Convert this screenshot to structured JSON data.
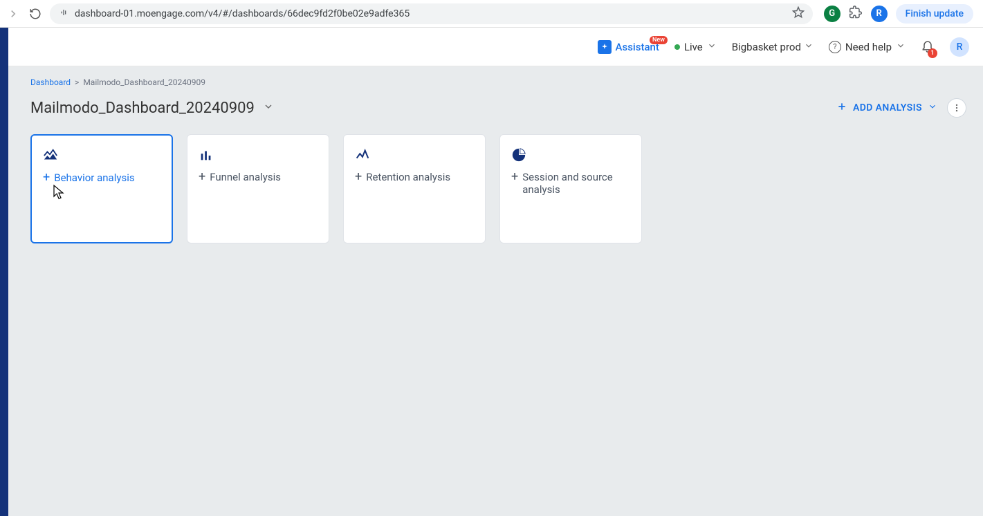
{
  "browser": {
    "url": "dashboard-01.moengage.com/v4/#/dashboards/66dec9fd2f0be02e9adfe365",
    "finish_update_label": "Finish update",
    "profile_initial": "R",
    "ext_g": "G"
  },
  "header": {
    "assistant_label": "Assistant",
    "assistant_badge": "New",
    "live_label": "Live",
    "workspace_label": "Bigbasket prod",
    "help_label": "Need help",
    "bell_count": "1",
    "avatar_initial": "R"
  },
  "breadcrumb": {
    "root": "Dashboard",
    "sep": ">",
    "current": "Mailmodo_Dashboard_20240909"
  },
  "title": "Mailmodo_Dashboard_20240909",
  "add_analysis_label": "ADD ANALYSIS",
  "cards": [
    {
      "label": "Behavior analysis",
      "active": true
    },
    {
      "label": "Funnel analysis",
      "active": false
    },
    {
      "label": "Retention analysis",
      "active": false
    },
    {
      "label": "Session and source analysis",
      "active": false
    }
  ]
}
